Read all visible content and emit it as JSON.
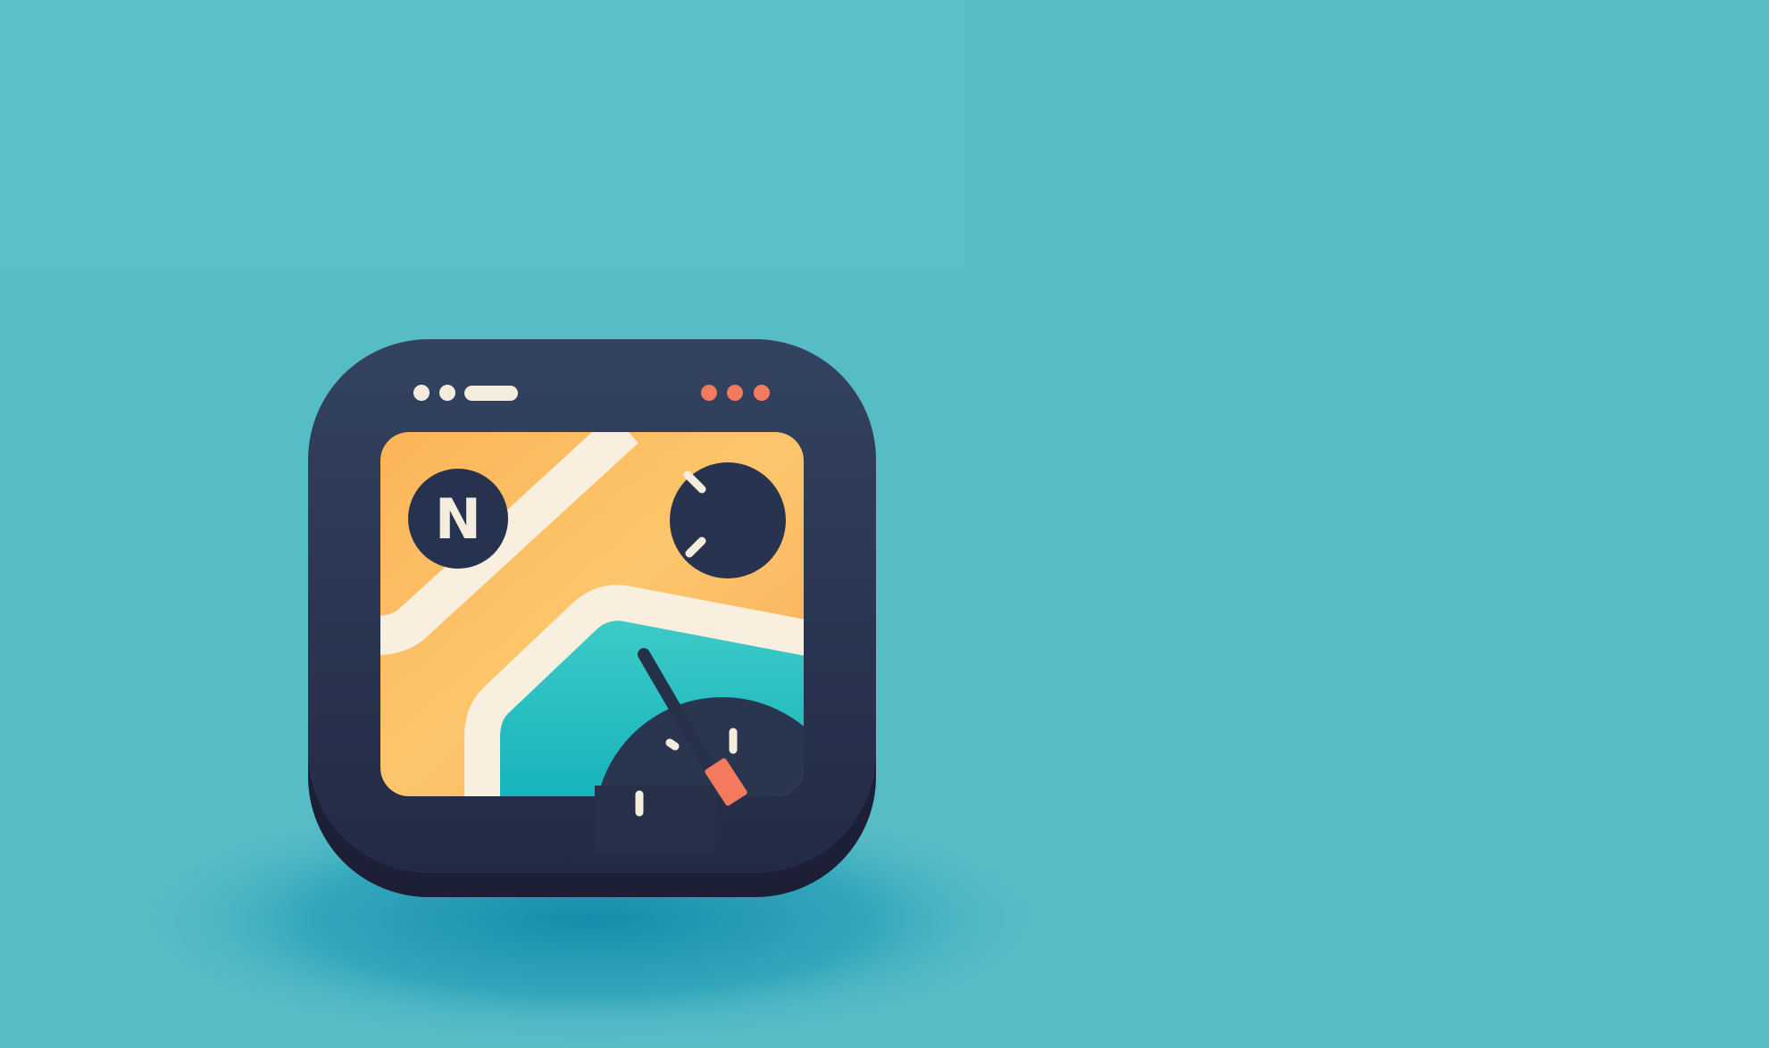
{
  "icon": {
    "compass_letter": "N",
    "name": "map-navigation-app-icon"
  },
  "colors": {
    "background": "#56bcc6",
    "background_shadow": "#1b97b3",
    "frame": "#2a3550",
    "map_orange": "#fbbf62",
    "road": "#f8efdf",
    "water": "#2cc0c0",
    "accent_red": "#f47a5e",
    "dot_light": "#f4ecdd"
  }
}
